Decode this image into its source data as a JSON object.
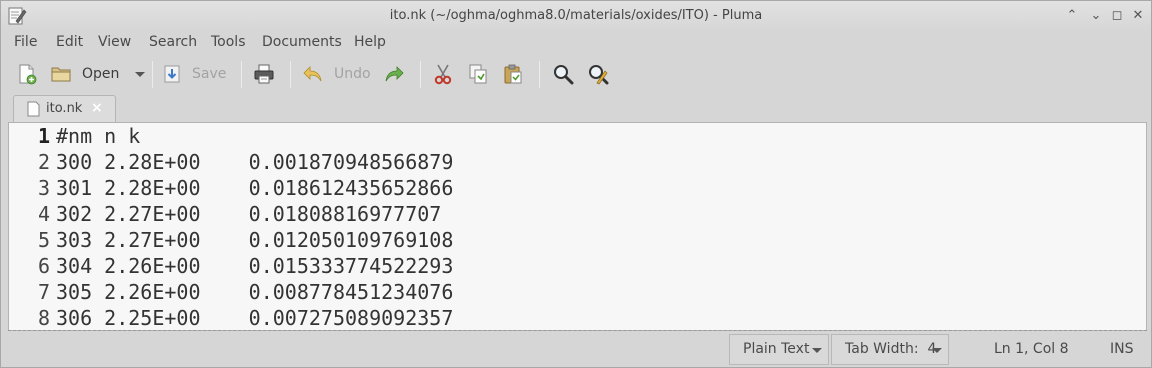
{
  "window": {
    "title": "ito.nk (~/oghma/oghma8.0/materials/oxides/ITO) - Pluma",
    "controls": {
      "minimize": "⌃",
      "restore_down": "⌄",
      "maximize": "◻",
      "close": "✕"
    }
  },
  "menu": [
    "File",
    "Edit",
    "View",
    "Search",
    "Tools",
    "Documents",
    "Help"
  ],
  "toolbar": {
    "open_label": "Open",
    "save_label": "Save",
    "undo_label": "Undo",
    "icons": [
      "new-document-icon",
      "open-folder-icon",
      "save-icon",
      "print-icon",
      "undo-icon",
      "redo-icon",
      "cut-icon",
      "copy-icon",
      "paste-icon",
      "find-icon",
      "find-replace-icon"
    ]
  },
  "tabs": [
    {
      "label": "ito.nk",
      "close": "×"
    }
  ],
  "editor": {
    "lines": [
      {
        "num": "1",
        "text": "#nm n k"
      },
      {
        "num": "2",
        "text": "300 2.28E+00    0.001870948566879"
      },
      {
        "num": "3",
        "text": "301 2.28E+00    0.018612435652866"
      },
      {
        "num": "4",
        "text": "302 2.27E+00    0.01808816977707"
      },
      {
        "num": "5",
        "text": "303 2.27E+00    0.012050109769108"
      },
      {
        "num": "6",
        "text": "304 2.26E+00    0.015333774522293"
      },
      {
        "num": "7",
        "text": "305 2.26E+00    0.008778451234076"
      },
      {
        "num": "8",
        "text": "306 2.25E+00    0.007275089092357"
      }
    ]
  },
  "statusbar": {
    "language": "Plain Text",
    "tab_width": "Tab Width:  4",
    "position": "Ln 1, Col 8",
    "mode": "INS"
  },
  "colors": {
    "chrome_bg": "#d6d6d6",
    "editor_bg": "#f7f7f7",
    "disabled_text": "#a3a3a3",
    "cut_red": "#c0392b",
    "redo_green": "#4a9a2a"
  }
}
